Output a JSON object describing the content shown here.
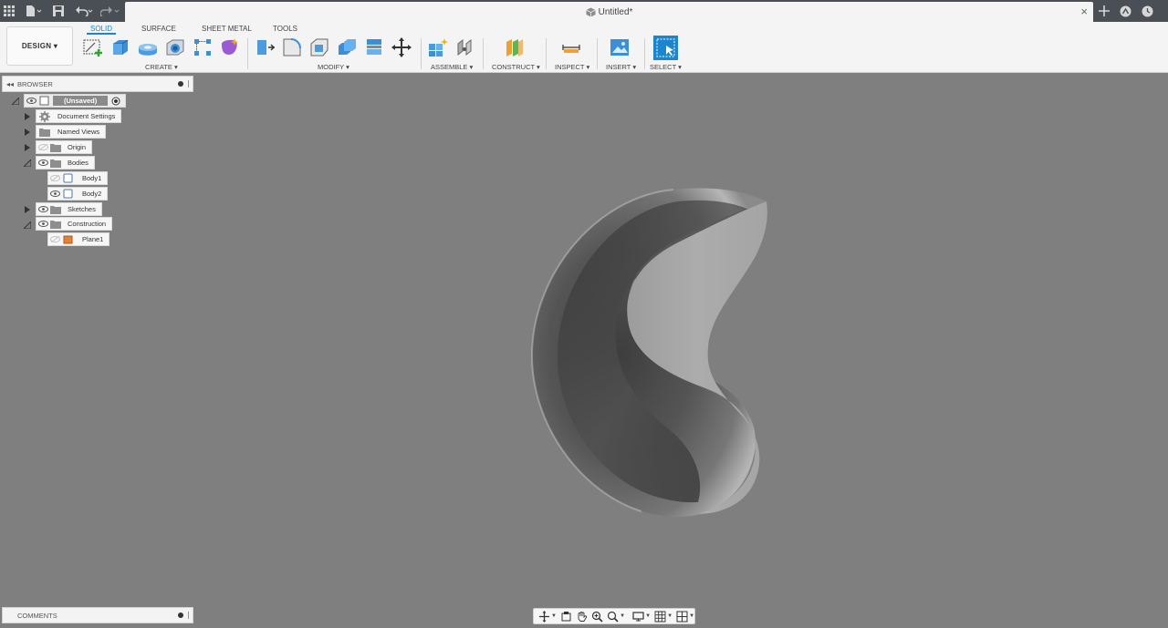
{
  "document": {
    "title": "Untitled*"
  },
  "workspace": {
    "label": "DESIGN ▾"
  },
  "ribbon": {
    "tabs": [
      "SOLID",
      "SURFACE",
      "SHEET METAL",
      "TOOLS"
    ],
    "active_tab": "SOLID",
    "groups": {
      "create": "CREATE ▾",
      "modify": "MODIFY ▾",
      "assemble": "ASSEMBLE ▾",
      "construct": "CONSTRUCT ▾",
      "inspect": "INSPECT ▾",
      "insert": "INSERT ▾",
      "select": "SELECT ▾"
    }
  },
  "browser": {
    "title": "BROWSER",
    "root": "(Unsaved)",
    "items": {
      "document_settings": "Document Settings",
      "named_views": "Named Views",
      "origin": "Origin",
      "bodies": "Bodies",
      "body1": "Body1",
      "body2": "Body2",
      "sketches": "Sketches",
      "construction": "Construction",
      "plane1": "Plane1"
    }
  },
  "comments": {
    "title": "COMMENTS"
  },
  "colors": {
    "accent": "#1a86d0",
    "viewport_bg": "#7f7f7f",
    "titlebar": "#4a4f55",
    "ribbon_bg": "#f4f4f4"
  }
}
